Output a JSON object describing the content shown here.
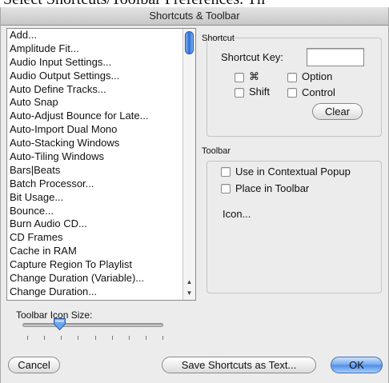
{
  "background_text": "Select Shortcuts/Toolbar Preferences. Th",
  "window": {
    "title": "Shortcuts & Toolbar"
  },
  "commands": [
    "Add...",
    "Amplitude Fit...",
    "Audio Input Settings...",
    "Audio Output Settings...",
    "Auto Define Tracks...",
    "Auto Snap",
    "Auto-Adjust Bounce for Late...",
    "Auto-Import Dual Mono",
    "Auto-Stacking Windows",
    "Auto-Tiling Windows",
    "Bars|Beats",
    "Batch Processor...",
    "Bit Usage...",
    "Bounce...",
    "Burn Audio CD...",
    "CD Frames",
    "Cache in RAM",
    "Capture Region To Playlist",
    "Change Duration (Variable)...",
    "Change Duration..."
  ],
  "shortcut": {
    "group_label": "Shortcut",
    "key_label": "Shortcut Key:",
    "key_value": "",
    "cmd_label": "⌘",
    "option_label": "Option",
    "shift_label": "Shift",
    "control_label": "Control",
    "clear_label": "Clear"
  },
  "toolbar": {
    "group_label": "Toolbar",
    "contextual_label": "Use in Contextual Popup",
    "place_label": "Place in Toolbar",
    "icon_label": "Icon..."
  },
  "icon_size": {
    "label": "Toolbar Icon Size:",
    "tick_count": 9,
    "value_fraction": 0.25
  },
  "buttons": {
    "cancel": "Cancel",
    "save_text": "Save Shortcuts as Text...",
    "ok": "OK"
  },
  "colors": {
    "accent": "#4d8de7",
    "window_bg": "#ececec"
  }
}
